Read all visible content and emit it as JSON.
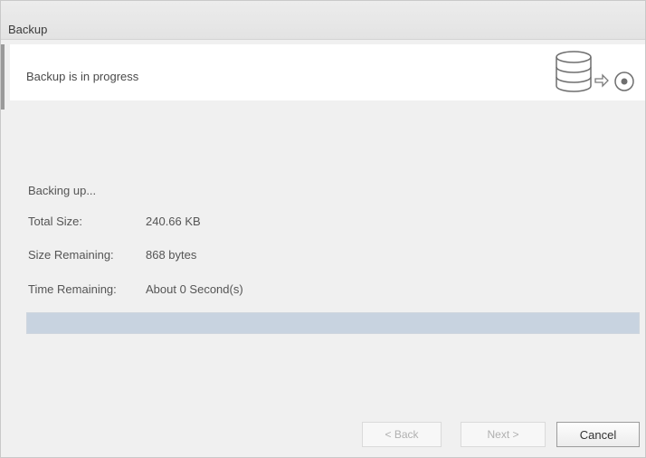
{
  "window": {
    "title": "Backup"
  },
  "header": {
    "message": "Backup is in progress",
    "icons": [
      "database-icon",
      "arrow-right-icon",
      "target-icon"
    ]
  },
  "status": {
    "action": "Backing up...",
    "rows": [
      {
        "label": "Total Size:",
        "value": "240.66 KB"
      },
      {
        "label": "Size Remaining:",
        "value": "868 bytes"
      },
      {
        "label": "Time Remaining:",
        "value": "About 0 Second(s)"
      }
    ]
  },
  "progress": {
    "fraction": 1.0
  },
  "buttons": {
    "back": "< Back",
    "next": "Next >",
    "cancel": "Cancel"
  },
  "colors": {
    "progress_fill": "#c8d3e0",
    "panel_background": "#f0f0f0"
  }
}
